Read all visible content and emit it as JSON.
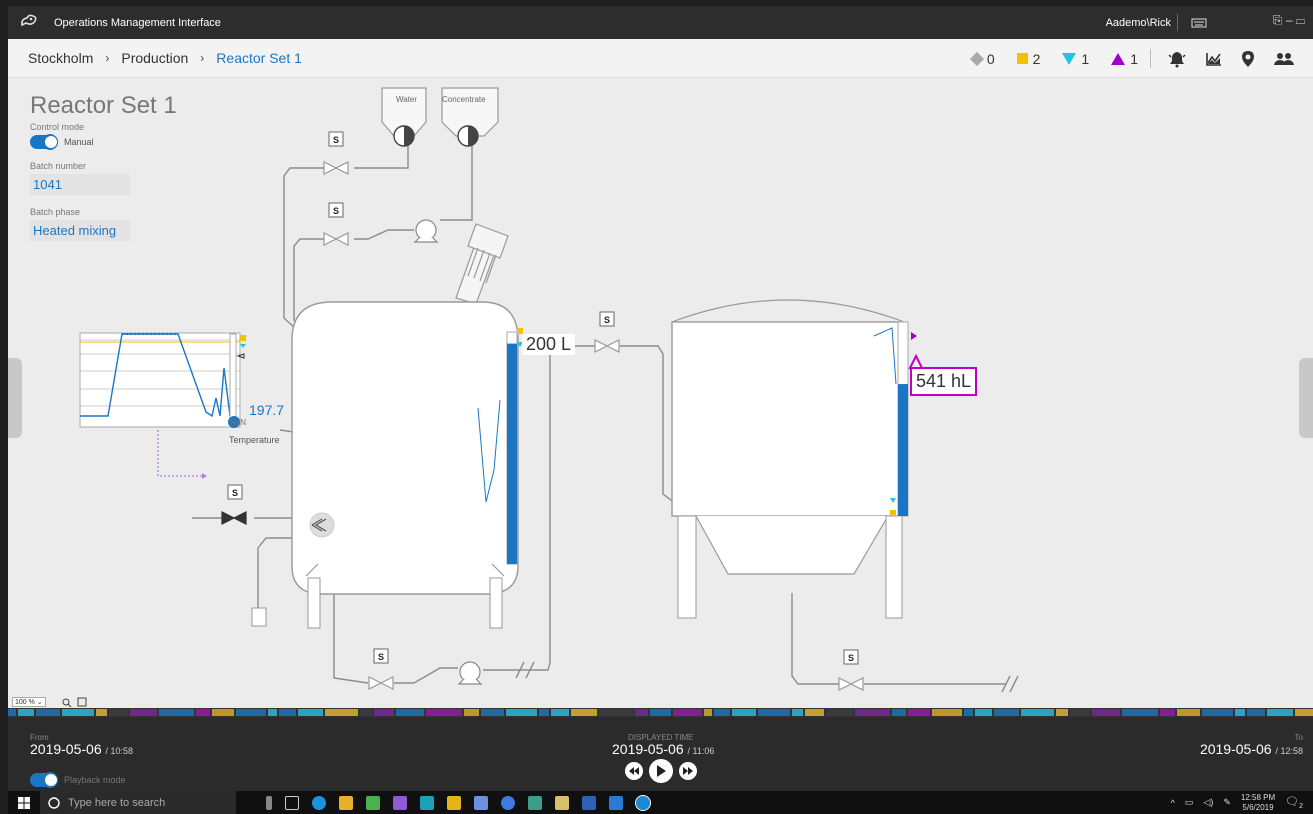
{
  "window": {
    "title": "Operations Management Interface",
    "user": "Aademo\\Rick",
    "controls": "⎘ – ▭"
  },
  "breadcrumb": [
    {
      "label": "Stockholm"
    },
    {
      "label": "Production"
    },
    {
      "label": "Reactor Set 1"
    }
  ],
  "breadcrumb_separator": "›",
  "status_counts": {
    "diamond": "0",
    "square": "2",
    "tri_down": "1",
    "tri_up": "1"
  },
  "status_colors": {
    "diamond": "#aaaaaa",
    "square": "#f2c200",
    "tri_down": "#22c4dd",
    "tri_up": "#a000c8",
    "accent": "#1a76c5"
  },
  "panel": {
    "title": "Reactor Set 1",
    "control_mode_label": "Control mode",
    "control_mode_value": "Manual",
    "batch_number_label": "Batch number",
    "batch_number_value": "1041",
    "batch_phase_label": "Batch phase",
    "batch_phase_value": "Heated mixing"
  },
  "diagram": {
    "tank1_level": "200 L",
    "tank2_level": "541 hL",
    "trend_value": "197.7",
    "trend_nan": "NaN",
    "temperature_label": "Temperature",
    "water_label": "Water",
    "concentrate_label": "Concentrate",
    "valve_symbol": "S",
    "tank1_level_fraction": 0.95,
    "tank2_level_fraction": 0.68
  },
  "zoom": {
    "value": "100 %"
  },
  "playback": {
    "from_label": "From",
    "from_date": "2019-05-06",
    "from_time": "/ 10:58",
    "displayed_label": "DISPLAYED TIME",
    "displayed_date": "2019-05-06",
    "displayed_time": "/ 11:06",
    "to_label": "To",
    "to_date": "2019-05-06",
    "to_time": "/ 12:58",
    "mode_label": "Playback mode"
  },
  "taskbar": {
    "search_placeholder": "Type here to search",
    "clock_time": "12:58 PM",
    "clock_date": "5/6/2019",
    "notification_count": "2"
  }
}
